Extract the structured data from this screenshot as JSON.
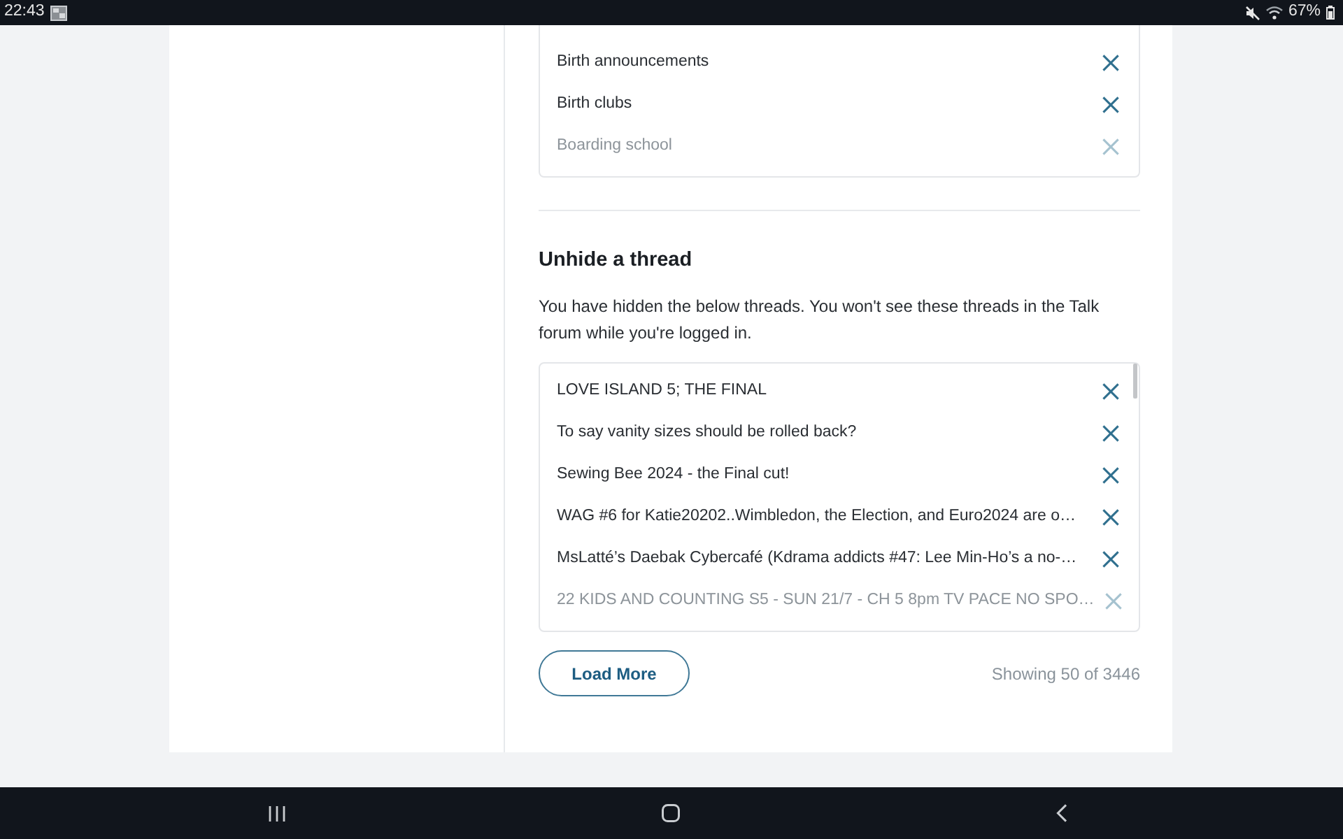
{
  "status_bar": {
    "time": "22:43",
    "battery": "67%"
  },
  "topics_list": {
    "items": [
      {
        "label": "Birth announcements",
        "faded": false
      },
      {
        "label": "Birth clubs",
        "faded": false
      },
      {
        "label": "Boarding school",
        "faded": true
      }
    ]
  },
  "unhide_thread": {
    "title": "Unhide a thread",
    "description": "You have hidden the below threads. You won't see these threads in the Talk forum while you're logged in.",
    "threads": [
      {
        "label": "LOVE ISLAND 5; THE FINAL",
        "faded": false
      },
      {
        "label": "To say vanity sizes should be rolled back?",
        "faded": false
      },
      {
        "label": "Sewing Bee 2024 - the Final cut!",
        "faded": false
      },
      {
        "label": "WAG #6 for Katie20202..Wimbledon, the Election, and Euro2024 are o…",
        "faded": false
      },
      {
        "label": "MsLatté’s Daebak Cybercafé (Kdrama addicts #47: Lee Min-Ho’s a no-…",
        "faded": false
      },
      {
        "label": "22 KIDS AND COUNTING S5 - SUN 21/7 - CH 5 8pm TV PACE NO SPO…",
        "faded": true
      }
    ],
    "load_more": "Load More",
    "count": "Showing 50 of 3446"
  }
}
